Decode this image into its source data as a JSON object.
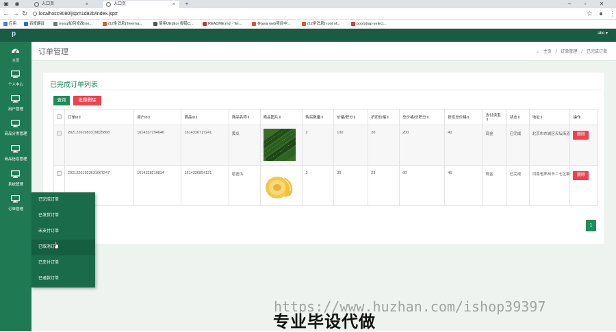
{
  "browser": {
    "tabs": [
      {
        "title": "入口页",
        "icon": "globe-icon"
      },
      {
        "title": "入口页",
        "icon": "globe-icon"
      }
    ],
    "new_tab_label": "+",
    "close_label": "×",
    "url": "localhost:8080/jspm1d82b/index.jsp#",
    "bookmarks": [
      {
        "label": "应用",
        "color": "#4a7de0"
      },
      {
        "label": "百度翻译",
        "color": "#2b6be6"
      },
      {
        "label": "mysql如何修改roo...",
        "color": "#777777"
      },
      {
        "label": "(12条消息) freema...",
        "color": "#e0552b"
      },
      {
        "label": "使用UEditor 报错C...",
        "color": "#555555"
      },
      {
        "label": "README.md · Ter...",
        "color": "#c0392b"
      },
      {
        "label": "在java web项目中...",
        "color": "#e0552b"
      },
      {
        "label": "(12条消息) root of...",
        "color": "#e0552b"
      },
      {
        "label": "bootstrap-select...",
        "color": "#e03a3a"
      }
    ]
  },
  "topbar": {
    "logo": "p",
    "user": "abo ▾"
  },
  "sidebar": {
    "items": [
      {
        "label": "主页",
        "icon": "dashboard-icon"
      },
      {
        "label": "个人中心",
        "icon": "monitor-icon"
      },
      {
        "label": "用户管理",
        "icon": "monitor-icon"
      },
      {
        "label": "商品分类管理",
        "icon": "monitor-icon"
      },
      {
        "label": "商品信息管理",
        "icon": "monitor-icon"
      },
      {
        "label": "系统管理",
        "icon": "monitor-icon"
      },
      {
        "label": "订单管理",
        "icon": "monitor-icon"
      }
    ]
  },
  "flyout": {
    "items": [
      "已完成订单",
      "已发货订单",
      "未支付订单",
      "已取消订单",
      "已支付订单",
      "已退款订单"
    ]
  },
  "page": {
    "title": "订单管理",
    "breadcrumb": {
      "home": "主页",
      "sep": "/",
      "section": "订单管理",
      "current": "已完成订单",
      "home_icon": "home-icon"
    }
  },
  "card": {
    "title": "已完成订单列表",
    "query_label": "查询",
    "batch_delete_label": "批量删除"
  },
  "table": {
    "columns": [
      "订单id⇕",
      "用户id⇕",
      "商品id⇕",
      "商品名称⇕",
      "商品图片⇕",
      "购买数量⇕",
      "价格/积分⇕",
      "折扣价格⇕",
      "总价格/总积分⇕",
      "折扣总价格⇕",
      "支付类型⇕",
      "状态⇕",
      "地址⇕",
      "操作"
    ],
    "rows": [
      {
        "order_id": "20212261983319825868",
        "user_id": "1614337294646",
        "product_id": "1614336717241",
        "name": "黄瓜",
        "image": "cucumber",
        "qty": "2",
        "price": "100",
        "discount_price": "20",
        "total": "200",
        "discount_total": "40",
        "pay_type": "现金",
        "status": "已完成",
        "address": "北京市东城区天坛街道...",
        "action": "删除"
      },
      {
        "order_id": "20212261923631067247",
        "user_id": "1614338210814",
        "product_id": "1614336854121",
        "name": "哈密瓜",
        "image": "melon",
        "qty": "2",
        "price": "30",
        "discount_price": "23",
        "total": "60",
        "discount_total": "46",
        "pay_type": "现金",
        "status": "已完成",
        "address": "河南省郑州市二七区解...",
        "action": "删除"
      }
    ]
  },
  "pagination": {
    "current": "1"
  },
  "overlay": {
    "watermark": "https://www.huzhan.com/ishop39397",
    "promo": "专业毕设代做"
  }
}
